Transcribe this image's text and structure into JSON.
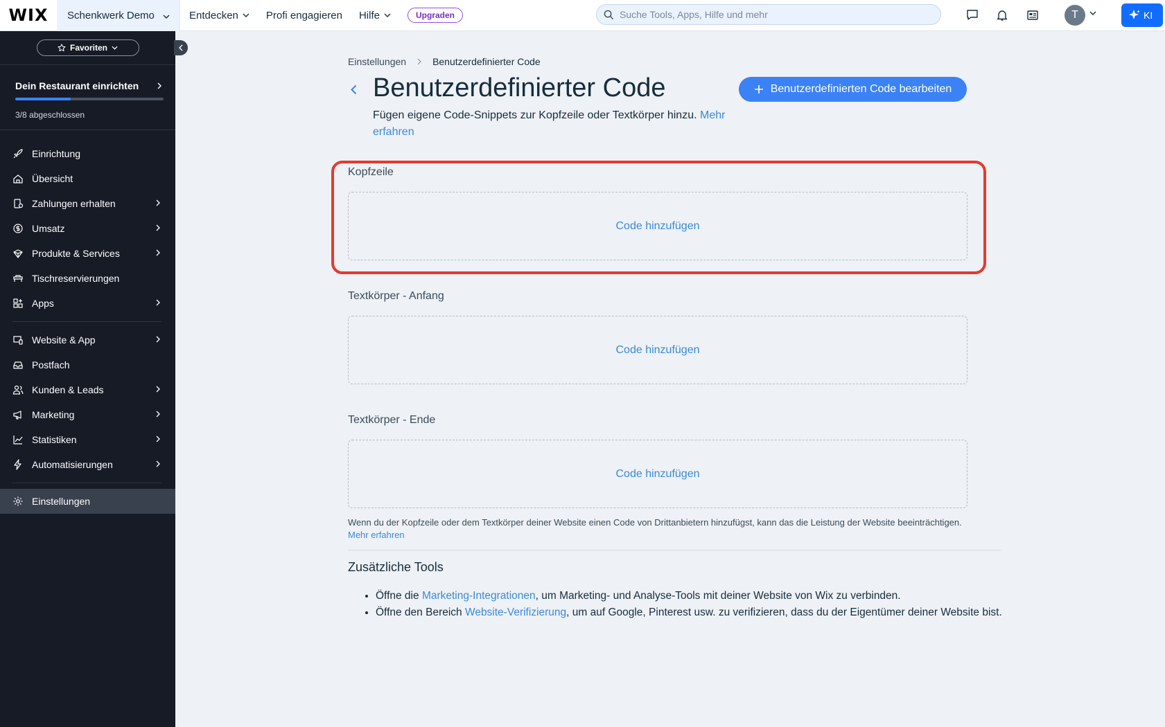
{
  "topbar": {
    "logo": "WIX",
    "site_name": "Schenkwerk Demo",
    "nav": [
      "Entdecken",
      "Profi engagieren",
      "Hilfe"
    ],
    "upgrade_label": "Upgraden",
    "search_placeholder": "Suche Tools, Apps, Hilfe und mehr",
    "avatar_initial": "T",
    "ai_label": "KI"
  },
  "sidebar": {
    "favorites_label": "Favoriten",
    "setup": {
      "title": "Dein Restaurant einrichten",
      "progress_text": "3/8 abgeschlossen",
      "progress_fraction": 0.375
    },
    "items": [
      {
        "label": "Einrichtung",
        "icon": "rocket-icon",
        "chevron": false
      },
      {
        "label": "Übersicht",
        "icon": "home-icon",
        "chevron": false
      },
      {
        "label": "Zahlungen erhalten",
        "icon": "payment-icon",
        "chevron": true
      },
      {
        "label": "Umsatz",
        "icon": "dollar-icon",
        "chevron": true
      },
      {
        "label": "Produkte & Services",
        "icon": "products-icon",
        "chevron": true
      },
      {
        "label": "Tischreservierungen",
        "icon": "table-icon",
        "chevron": false
      },
      {
        "label": "Apps",
        "icon": "apps-icon",
        "chevron": true
      },
      {
        "label": "Website & App",
        "icon": "website-icon",
        "chevron": true
      },
      {
        "label": "Postfach",
        "icon": "inbox-icon",
        "chevron": false
      },
      {
        "label": "Kunden & Leads",
        "icon": "people-icon",
        "chevron": true
      },
      {
        "label": "Marketing",
        "icon": "megaphone-icon",
        "chevron": true
      },
      {
        "label": "Statistiken",
        "icon": "chart-icon",
        "chevron": true
      },
      {
        "label": "Automatisierungen",
        "icon": "bolt-icon",
        "chevron": true
      },
      {
        "label": "Einstellungen",
        "icon": "gear-icon",
        "chevron": false,
        "active": true
      }
    ]
  },
  "main": {
    "breadcrumb": [
      "Einstellungen",
      "Benutzerdefinierter Code"
    ],
    "title": "Benutzerdefinierter Code",
    "subtitle": "Fügen eigene Code-Snippets zur Kopfzeile oder Textkörper hinzu.",
    "subtitle_link": "Mehr erfahren",
    "primary_button": "Benutzerdefinierten Code bearbeiten",
    "sections": [
      {
        "label": "Kopfzeile",
        "action": "Code hinzufügen"
      },
      {
        "label": "Textkörper - Anfang",
        "action": "Code hinzufügen"
      },
      {
        "label": "Textkörper - Ende",
        "action": "Code hinzufügen"
      }
    ],
    "notice": "Wenn du der Kopfzeile oder dem Textkörper deiner Website einen Code von Drittanbietern hinzufügst, kann das die Leistung der Website beeinträchtigen.",
    "notice_link": "Mehr erfahren",
    "tools_title": "Zusätzliche Tools",
    "tools": [
      {
        "before": "Öffne die ",
        "link": "Marketing-Integrationen",
        "after": ", um Marketing- und Analyse-Tools mit deiner Website von Wix zu verbinden."
      },
      {
        "before": "Öffne den Bereich ",
        "link": "Website-Verifizierung",
        "after": ", um auf Google, Pinterest usw. zu verifizieren, dass du der Eigentümer deiner Website bist."
      }
    ]
  },
  "colors": {
    "accent": "#3b82f6",
    "link": "#3b8ad8",
    "highlight": "#e53a2e",
    "sidebar_bg": "#161b26"
  }
}
